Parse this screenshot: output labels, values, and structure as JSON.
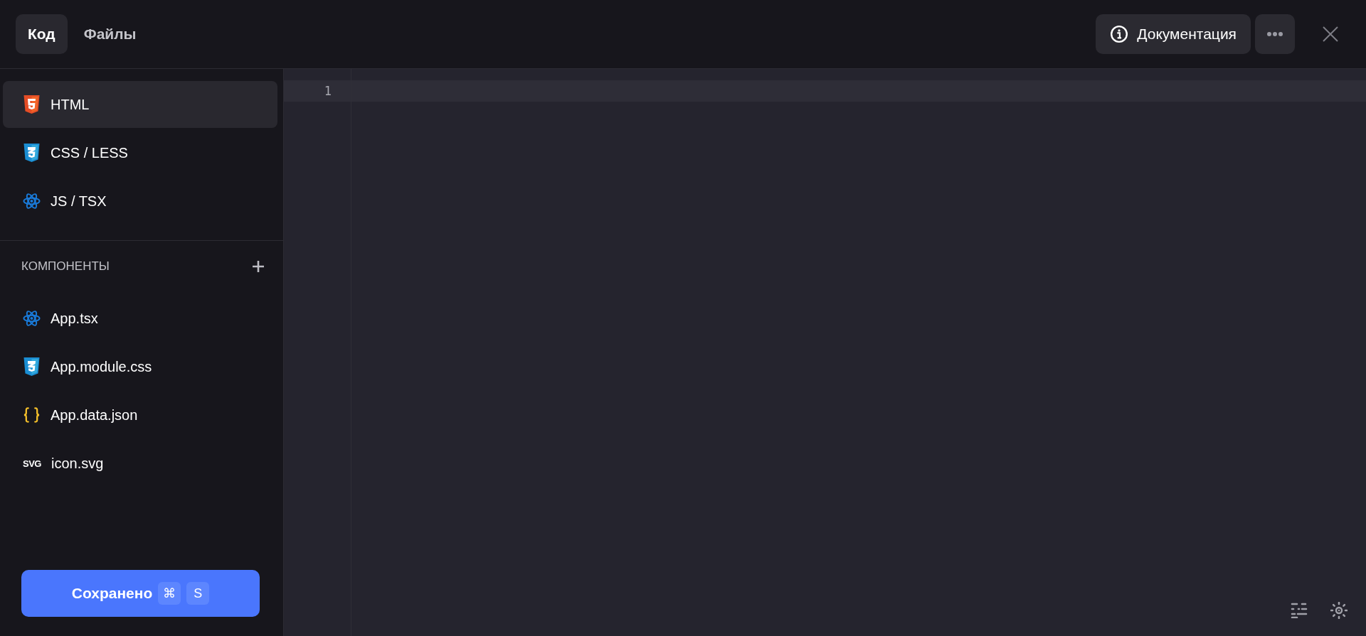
{
  "tabs": [
    {
      "label": "Код",
      "selected": true
    },
    {
      "label": "Файлы",
      "selected": false
    }
  ],
  "header_buttons": {
    "docs": "Документация"
  },
  "languages": [
    {
      "label": "HTML",
      "kind": "html",
      "selected": true
    },
    {
      "label": "CSS / LESS",
      "kind": "css",
      "selected": false
    },
    {
      "label": "JS / TSX",
      "kind": "react",
      "selected": false
    }
  ],
  "components": {
    "title": "КОМПОНЕНТЫ",
    "files": [
      {
        "label": "App.tsx",
        "kind": "react",
        "selected": false
      },
      {
        "label": "App.module.css",
        "kind": "css",
        "selected": false
      },
      {
        "label": "App.data.json",
        "kind": "json",
        "selected": false
      },
      {
        "label": "icon.svg",
        "kind": "svg",
        "badge": "SVG",
        "selected": false
      }
    ]
  },
  "save_button": {
    "label": "Сохранено",
    "keys": [
      "⌘",
      "S"
    ]
  },
  "editor": {
    "line_numbers": [
      "1"
    ]
  }
}
